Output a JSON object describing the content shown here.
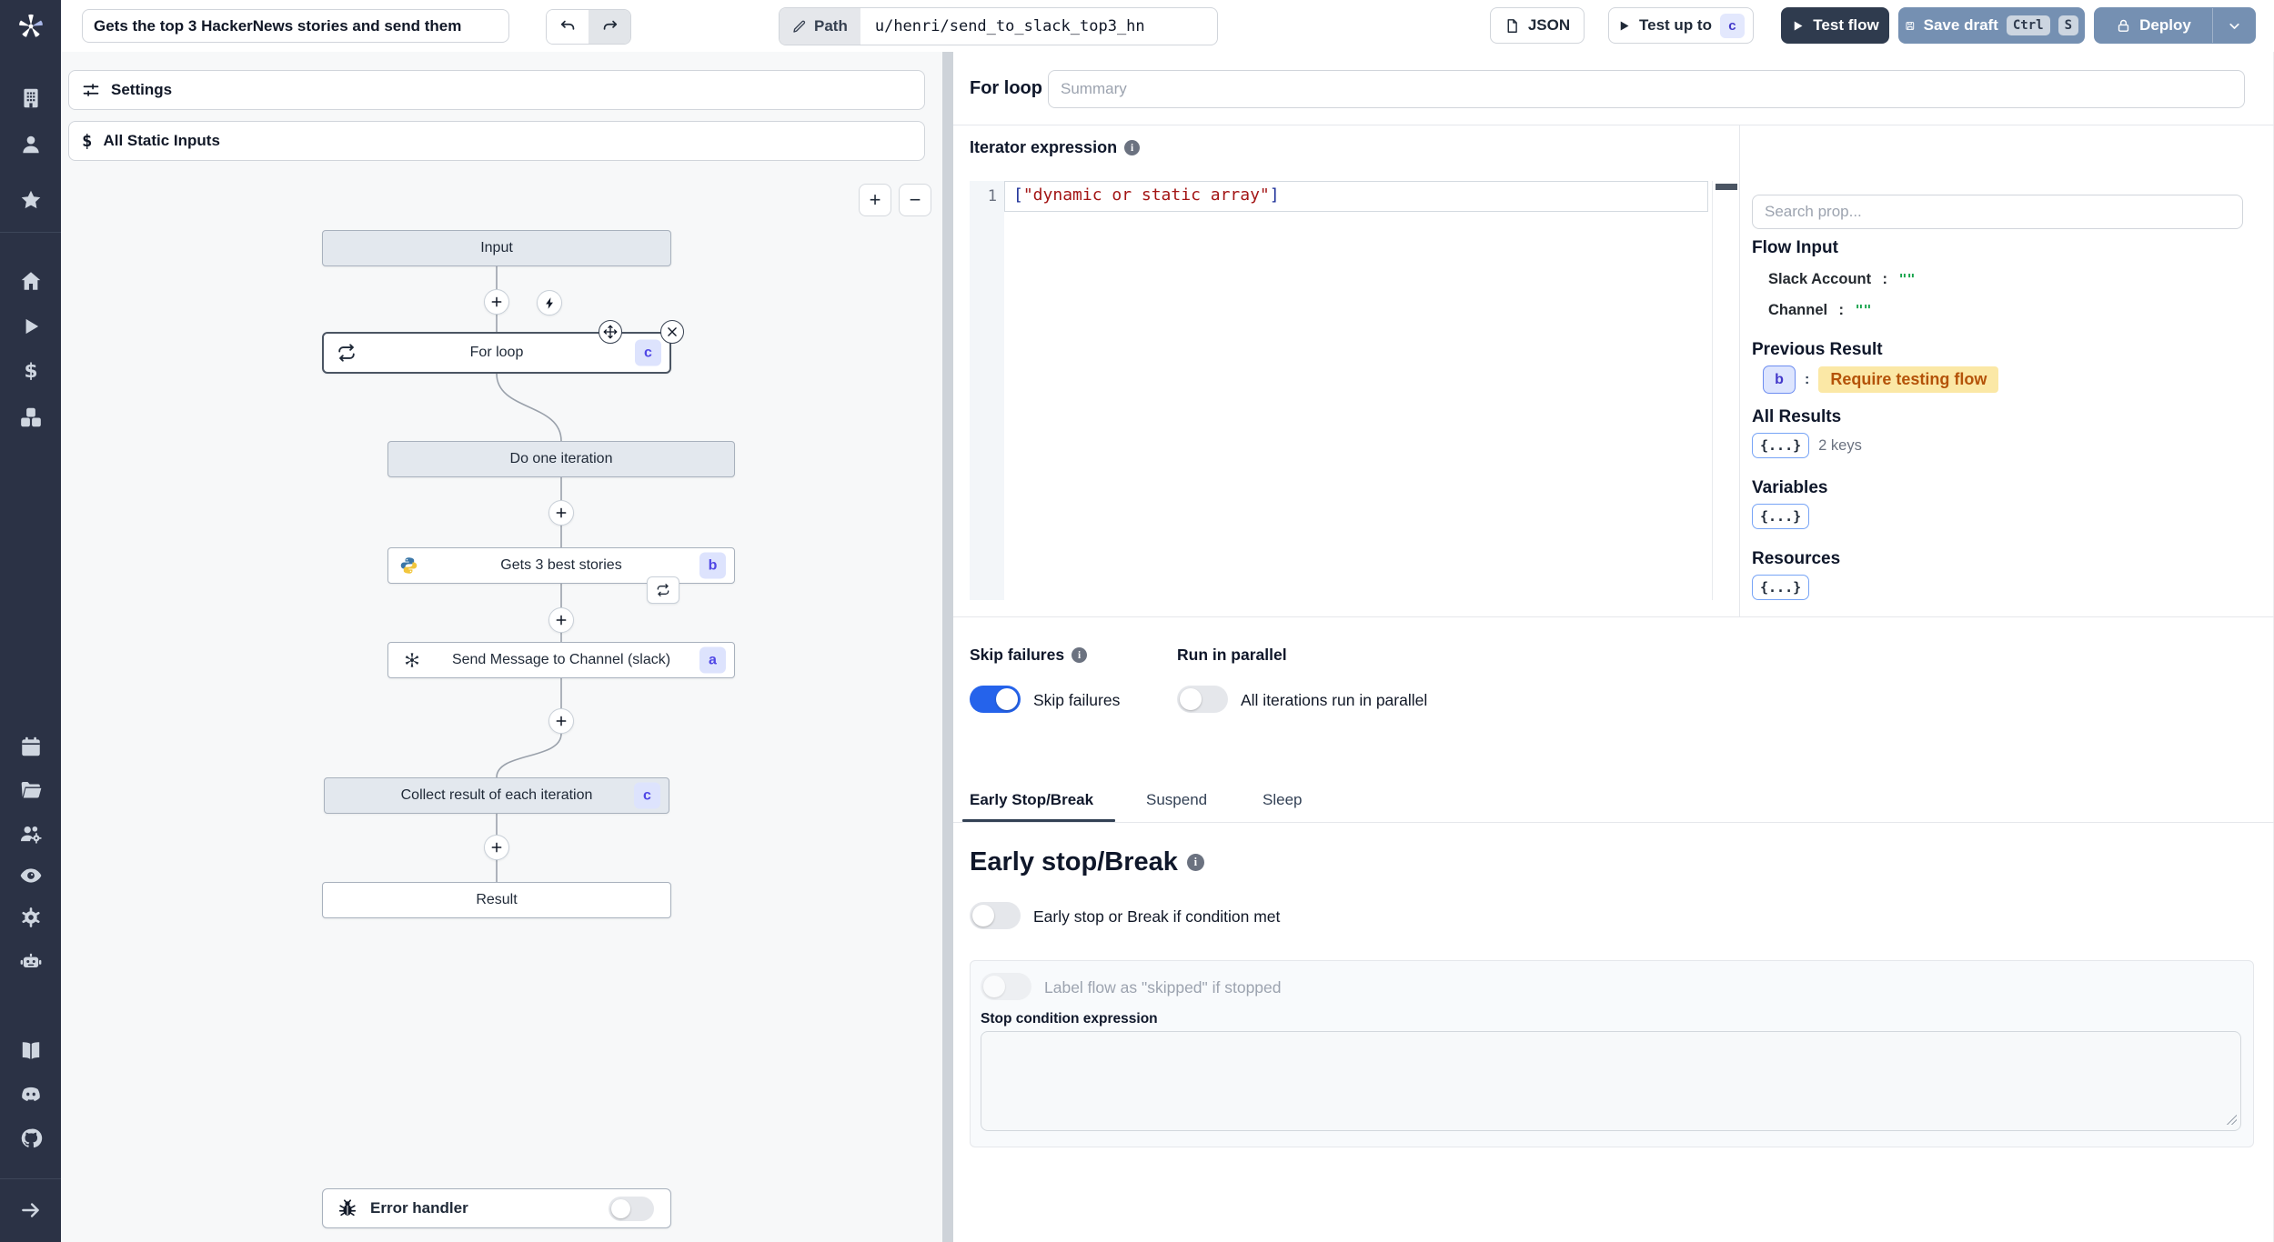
{
  "topbar": {
    "title_value": "Gets the top 3 HackerNews stories and send them",
    "path_label": "Path",
    "path_value": "u/henri/send_to_slack_top3_hn",
    "json_button": "JSON",
    "test_up_to_label": "Test up to",
    "test_up_to_badge": "c",
    "test_flow_label": "Test flow",
    "save_draft_label": "Save draft",
    "save_draft_kbd1": "Ctrl",
    "save_draft_kbd2": "S",
    "deploy_label": "Deploy"
  },
  "left_panel": {
    "settings_label": "Settings",
    "static_inputs_label": "All Static Inputs",
    "zoom_in": "+",
    "zoom_out": "−",
    "error_handler_label": "Error handler"
  },
  "graph": {
    "nodes": {
      "input": {
        "label": "Input"
      },
      "for_loop": {
        "label": "For loop",
        "badge": "c"
      },
      "do_one_iteration": {
        "label": "Do one iteration"
      },
      "gets_stories": {
        "label": "Gets 3 best stories",
        "badge": "b"
      },
      "send_message": {
        "label": "Send Message to Channel (slack)",
        "badge": "a"
      },
      "collect_result": {
        "label": "Collect result of each iteration",
        "badge": "c"
      },
      "result": {
        "label": "Result"
      }
    }
  },
  "inspector": {
    "step_name": "For loop",
    "summary_placeholder": "Summary",
    "iterator_label": "Iterator expression",
    "editor": {
      "line_number": "1",
      "bracket_open": "[",
      "string_value": "\"dynamic or static array\"",
      "bracket_close": "]"
    },
    "props": {
      "search_placeholder": "Search prop...",
      "flow_input_label": "Flow Input",
      "colon": ":",
      "fields": [
        {
          "key": "Slack Account",
          "value": "\"\""
        },
        {
          "key": "Channel",
          "value": "\"\""
        }
      ],
      "previous_result_label": "Previous Result",
      "prev_badge": "b",
      "prev_value": "Require testing flow",
      "all_results_label": "All Results",
      "object_chip": "{...}",
      "all_results_meta": "2 keys",
      "variables_label": "Variables",
      "resources_label": "Resources"
    },
    "skip_failures_heading": "Skip failures",
    "skip_failures_label": "Skip failures",
    "run_parallel_heading": "Run in parallel",
    "run_parallel_label": "All iterations run in parallel",
    "tabs": [
      {
        "label": "Early Stop/Break"
      },
      {
        "label": "Suspend"
      },
      {
        "label": "Sleep"
      }
    ],
    "early_stop": {
      "heading": "Early stop/Break",
      "toggle_label": "Early stop or Break if condition met",
      "skipped_toggle_label": "Label flow as \"skipped\" if stopped",
      "condition_label": "Stop condition expression"
    }
  },
  "colors": {
    "accent_blue": "#2563eb",
    "steel_button": "#7590b2",
    "dark_button": "#2f3b4e",
    "badge_indigo_bg": "#dde3fd",
    "badge_indigo_text": "#4f46e5",
    "amber_bg": "#fbe8a6",
    "amber_text": "#b45309",
    "string_red": "#a31515",
    "bracket_blue": "#1b2e97",
    "quote_green": "#16a34a"
  }
}
